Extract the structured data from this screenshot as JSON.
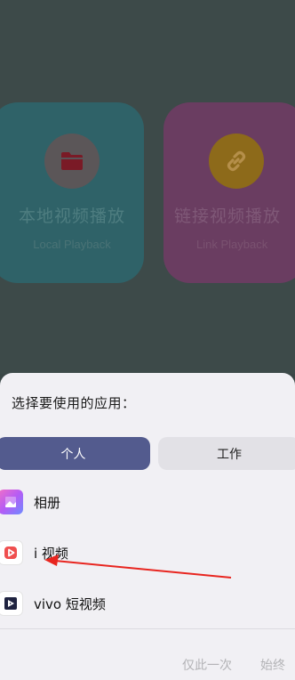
{
  "background_app": {
    "cards": [
      {
        "title": "本地视频播放",
        "subtitle": "Local Playback",
        "icon": "folder-icon",
        "color": "#2f6268"
      },
      {
        "title": "链接视频播放",
        "subtitle": "Link Playback",
        "icon": "link-icon",
        "color": "#6a3d61"
      }
    ]
  },
  "chooser": {
    "title": "选择要使用的应用：",
    "tabs": [
      {
        "label": "个人",
        "selected": true
      },
      {
        "label": "工作",
        "selected": false
      }
    ],
    "apps": [
      {
        "label": "相册",
        "icon": "album-icon"
      },
      {
        "label": "i 视频",
        "icon": "i-video-icon"
      },
      {
        "label": "vivo 短视频",
        "icon": "vivo-short-video-icon"
      }
    ],
    "actions": {
      "once_label": "仅此一次",
      "always_label": "始终"
    }
  },
  "colors": {
    "accent": "#535b8e",
    "annotation_arrow": "#e8251f"
  }
}
